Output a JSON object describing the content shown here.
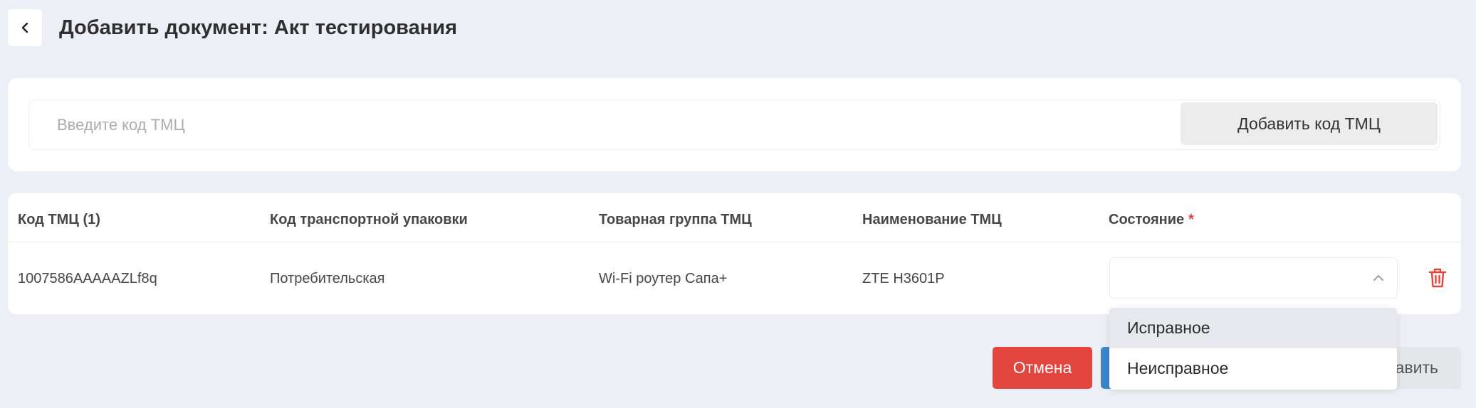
{
  "header": {
    "title": "Добавить документ: Акт тестирования",
    "back_icon": "chevron-left-icon"
  },
  "search": {
    "placeholder": "Введите код ТМЦ",
    "value": "",
    "add_button_label": "Добавить код ТМЦ"
  },
  "table": {
    "columns": [
      "Код ТМЦ (1)",
      "Код транспортной упаковки",
      "Товарная группа ТМЦ",
      "Наименование ТМЦ",
      "Состояние"
    ],
    "required_mark": "*",
    "rows": [
      {
        "code": "1007586AAAAAZLf8q",
        "package": "Потребительская",
        "group": "Wi-Fi роутер Сапа+",
        "name": "ZTE H3601P",
        "state": ""
      }
    ]
  },
  "state_dropdown": {
    "open": true,
    "options": [
      "Исправное",
      "Неисправное"
    ],
    "hovered_index": 0
  },
  "footer": {
    "cancel_label": "Отмена",
    "save_label_visible": "авить"
  },
  "colors": {
    "background": "#eceff6",
    "danger": "#e2453e",
    "primary": "#3c86c8",
    "required": "#e5453f",
    "trash_icon": "#e2453e"
  }
}
